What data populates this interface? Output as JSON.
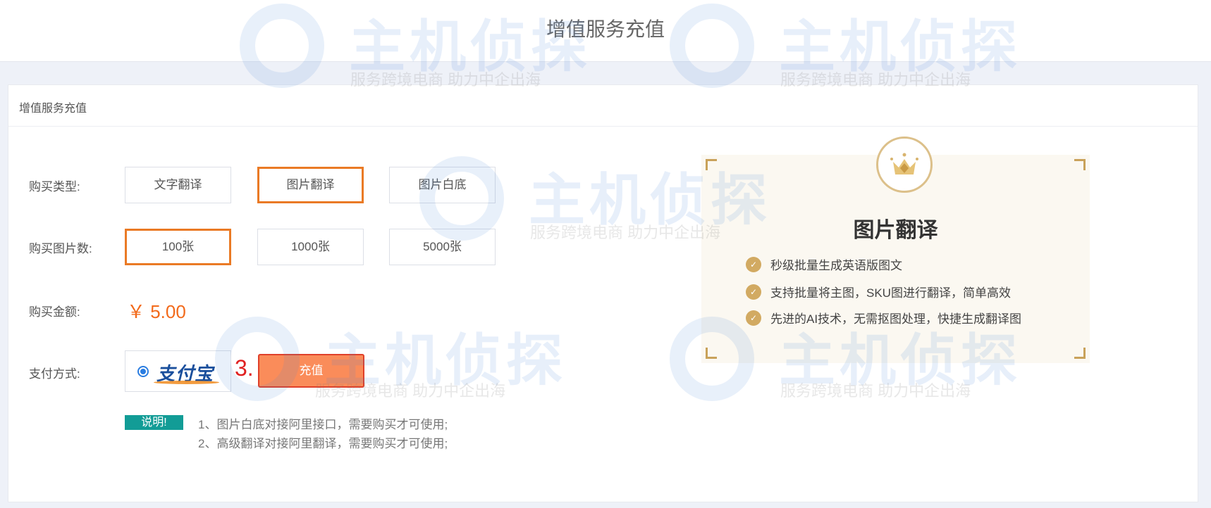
{
  "header": {
    "title": "增值服务充值"
  },
  "card": {
    "title": "增值服务充值"
  },
  "form": {
    "type_label": "购买类型:",
    "types": [
      "文字翻译",
      "图片翻译",
      "图片白底"
    ],
    "count_label": "购买图片数:",
    "counts": [
      "100张",
      "1000张",
      "5000张"
    ],
    "amount_label": "购买金额:",
    "amount": "￥ 5.00",
    "pay_label": "支付方式:",
    "pay_method": "支付宝",
    "step_marker": "3.",
    "submit": "充值",
    "note_badge": "说明!",
    "notes": [
      "1、图片白底对接阿里接口，需要购买才可使用;",
      "2、高级翻译对接阿里翻译，需要购买才可使用;"
    ]
  },
  "panel": {
    "title": "图片翻译",
    "features": [
      "秒级批量生成英语版图文",
      "支持批量将主图，SKU图进行翻译，简单高效",
      "先进的AI技术，无需抠图处理，快捷生成翻译图"
    ]
  },
  "watermark": {
    "brand": "主机侦探",
    "slogan": "服务跨境电商 助力中企出海"
  },
  "colors": {
    "accent": "#ea7a25",
    "price": "#f26a1b",
    "gold": "#d2aa62",
    "note": "#129c96"
  }
}
